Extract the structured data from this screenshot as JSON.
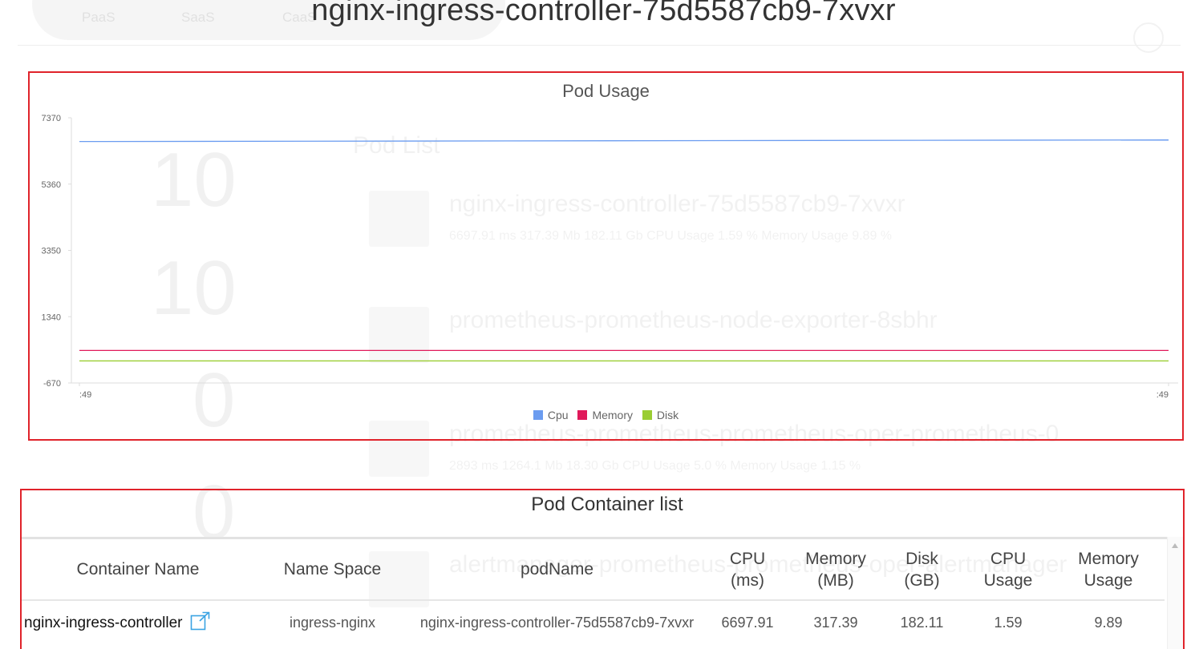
{
  "page": {
    "title": "nginx-ingress-controller-75d5587cb9-7xvxr"
  },
  "background": {
    "tabs": [
      "PaaS",
      "SaaS",
      "CaaS"
    ],
    "pod_list_title": "Pod List",
    "counts": [
      "10",
      "10",
      "0",
      "0"
    ],
    "pods": [
      {
        "name": "nginx-ingress-controller-75d5587cb9-7xvxr",
        "meta": "6697.91 ms   317.39 Mb   182.11 Gb   CPU Usage 1.59 %   Memory Usage 9.89 %"
      },
      {
        "name": "prometheus-prometheus-node-exporter-8sbhr",
        "meta": ""
      },
      {
        "name": "prometheus-prometheus-prometheus-oper-prometheus-0",
        "meta": "2893 ms   1264.1 Mb   18.30 Gb   CPU Usage 5.0 %   Memory Usage 1.15 %"
      },
      {
        "name": "alertmanager-prometheus-prometheus-oper-alertmanager",
        "meta": ""
      }
    ]
  },
  "chart": {
    "title": "Pod Usage",
    "legend": [
      {
        "label": "Cpu",
        "color": "#6b9cf0"
      },
      {
        "label": "Memory",
        "color": "#e0195a"
      },
      {
        "label": "Disk",
        "color": "#9acd32"
      }
    ]
  },
  "chart_data": {
    "type": "line",
    "title": "Pod Usage",
    "x": [
      ":49",
      ":49"
    ],
    "y_ticks": [
      "7370",
      "5360",
      "3350",
      "1340",
      "-670"
    ],
    "ylim": [
      -670,
      7370
    ],
    "grid": false,
    "legend_position": "bottom",
    "series": [
      {
        "name": "Cpu",
        "color": "#6b9cf0",
        "values": [
          6650,
          6697.91
        ]
      },
      {
        "name": "Memory",
        "color": "#e0195a",
        "values": [
          317.39,
          317.39
        ]
      },
      {
        "name": "Disk",
        "color": "#9acd32",
        "values": [
          0,
          0
        ]
      }
    ]
  },
  "table": {
    "title": "Pod Container list",
    "headers": [
      {
        "line1": "Container Name",
        "line2": ""
      },
      {
        "line1": "Name Space",
        "line2": ""
      },
      {
        "line1": "podName",
        "line2": ""
      },
      {
        "line1": "CPU",
        "line2": "(ms)"
      },
      {
        "line1": "Memory",
        "line2": "(MB)"
      },
      {
        "line1": "Disk",
        "line2": "(GB)"
      },
      {
        "line1": "CPU",
        "line2": "Usage"
      },
      {
        "line1": "Memory",
        "line2": "Usage"
      }
    ],
    "rows": [
      {
        "container_name": "nginx-ingress-controller",
        "name_space": "ingress-nginx",
        "pod_name": "nginx-ingress-controller-75d5587cb9-7xvxr",
        "cpu": "6697.91",
        "memory": "317.39",
        "disk": "182.11",
        "cpu_usage": "1.59",
        "memory_usage": "9.89",
        "link_icon": "external-link-icon"
      }
    ]
  }
}
